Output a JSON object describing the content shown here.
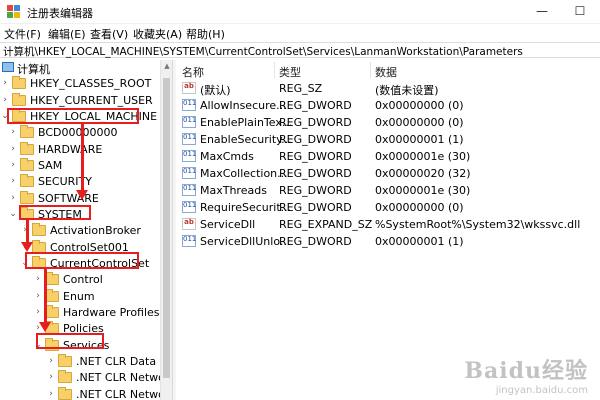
{
  "window": {
    "title": "注册表编辑器",
    "controls": {
      "minimize": "—",
      "maximize": "☐"
    }
  },
  "menu": [
    "文件(F)",
    "编辑(E)",
    "查看(V)",
    "收藏夹(A)",
    "帮助(H)"
  ],
  "address": "计算机\\HKEY_LOCAL_MACHINE\\SYSTEM\\CurrentControlSet\\Services\\LanmanWorkstation\\Parameters",
  "tree": {
    "root": "计算机",
    "nodes": [
      {
        "label": "HKEY_CLASSES_ROOT",
        "expander": "›"
      },
      {
        "label": "HKEY_CURRENT_USER",
        "expander": "›"
      },
      {
        "label": "HKEY_LOCAL_MACHINE",
        "expander": "⌄"
      },
      {
        "label": "BCD00000000",
        "expander": "›"
      },
      {
        "label": "HARDWARE",
        "expander": "›"
      },
      {
        "label": "SAM",
        "expander": "›"
      },
      {
        "label": "SECURITY",
        "expander": "›"
      },
      {
        "label": "SOFTWARE",
        "expander": "›"
      },
      {
        "label": "SYSTEM",
        "expander": "⌄"
      },
      {
        "label": "ActivationBroker",
        "expander": "›"
      },
      {
        "label": "ControlSet001",
        "expander": "›"
      },
      {
        "label": "CurrentControlSet",
        "expander": "⌄"
      },
      {
        "label": "Control",
        "expander": "›"
      },
      {
        "label": "Enum",
        "expander": "›"
      },
      {
        "label": "Hardware Profiles",
        "expander": "›"
      },
      {
        "label": "Policies",
        "expander": "›"
      },
      {
        "label": "Services",
        "expander": "⌄"
      },
      {
        "label": ".NET CLR Data",
        "expander": "›"
      },
      {
        "label": ".NET CLR Network",
        "expander": "›"
      },
      {
        "label": ".NET CLR Network",
        "expander": "›"
      }
    ]
  },
  "list": {
    "columns": {
      "name": "名称",
      "type": "类型",
      "data": "数据"
    },
    "rows": [
      {
        "icon": "ab",
        "name": "(默认)",
        "type": "REG_SZ",
        "data": "(数值未设置)"
      },
      {
        "icon": "011",
        "name": "AllowInsecure...",
        "type": "REG_DWORD",
        "data": "0x00000000 (0)"
      },
      {
        "icon": "011",
        "name": "EnablePlainTex...",
        "type": "REG_DWORD",
        "data": "0x00000000 (0)"
      },
      {
        "icon": "011",
        "name": "EnableSecurity...",
        "type": "REG_DWORD",
        "data": "0x00000001 (1)"
      },
      {
        "icon": "011",
        "name": "MaxCmds",
        "type": "REG_DWORD",
        "data": "0x0000001e (30)"
      },
      {
        "icon": "011",
        "name": "MaxCollection...",
        "type": "REG_DWORD",
        "data": "0x00000020 (32)"
      },
      {
        "icon": "011",
        "name": "MaxThreads",
        "type": "REG_DWORD",
        "data": "0x0000001e (30)"
      },
      {
        "icon": "011",
        "name": "RequireSecurit...",
        "type": "REG_DWORD",
        "data": "0x00000000 (0)"
      },
      {
        "icon": "ab",
        "name": "ServiceDll",
        "type": "REG_EXPAND_SZ",
        "data": "%SystemRoot%\\System32\\wkssvc.dll"
      },
      {
        "icon": "011",
        "name": "ServiceDllUnlo...",
        "type": "REG_DWORD",
        "data": "0x00000001 (1)"
      }
    ]
  },
  "watermark": {
    "logo": "Baidu经验",
    "url": "jingyan.baidu.com"
  },
  "colors": {
    "annotation": "#e61e1e",
    "folder": "#f7d06a"
  }
}
